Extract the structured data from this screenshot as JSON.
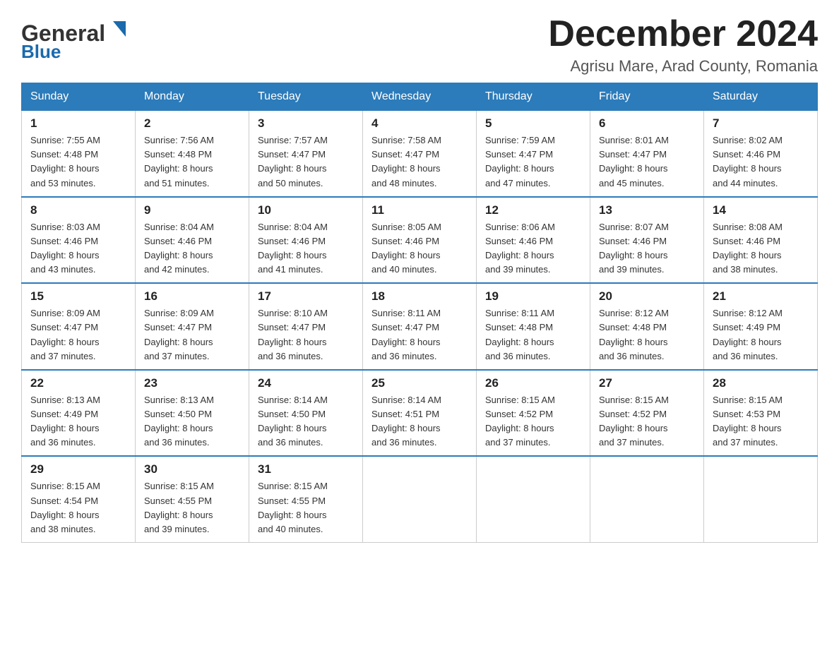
{
  "header": {
    "logo_general": "General",
    "logo_blue": "Blue",
    "month_title": "December 2024",
    "subtitle": "Agrisu Mare, Arad County, Romania"
  },
  "days_of_week": [
    "Sunday",
    "Monday",
    "Tuesday",
    "Wednesday",
    "Thursday",
    "Friday",
    "Saturday"
  ],
  "weeks": [
    [
      {
        "day": "1",
        "sunrise": "7:55 AM",
        "sunset": "4:48 PM",
        "daylight": "8 hours and 53 minutes."
      },
      {
        "day": "2",
        "sunrise": "7:56 AM",
        "sunset": "4:48 PM",
        "daylight": "8 hours and 51 minutes."
      },
      {
        "day": "3",
        "sunrise": "7:57 AM",
        "sunset": "4:47 PM",
        "daylight": "8 hours and 50 minutes."
      },
      {
        "day": "4",
        "sunrise": "7:58 AM",
        "sunset": "4:47 PM",
        "daylight": "8 hours and 48 minutes."
      },
      {
        "day": "5",
        "sunrise": "7:59 AM",
        "sunset": "4:47 PM",
        "daylight": "8 hours and 47 minutes."
      },
      {
        "day": "6",
        "sunrise": "8:01 AM",
        "sunset": "4:47 PM",
        "daylight": "8 hours and 45 minutes."
      },
      {
        "day": "7",
        "sunrise": "8:02 AM",
        "sunset": "4:46 PM",
        "daylight": "8 hours and 44 minutes."
      }
    ],
    [
      {
        "day": "8",
        "sunrise": "8:03 AM",
        "sunset": "4:46 PM",
        "daylight": "8 hours and 43 minutes."
      },
      {
        "day": "9",
        "sunrise": "8:04 AM",
        "sunset": "4:46 PM",
        "daylight": "8 hours and 42 minutes."
      },
      {
        "day": "10",
        "sunrise": "8:04 AM",
        "sunset": "4:46 PM",
        "daylight": "8 hours and 41 minutes."
      },
      {
        "day": "11",
        "sunrise": "8:05 AM",
        "sunset": "4:46 PM",
        "daylight": "8 hours and 40 minutes."
      },
      {
        "day": "12",
        "sunrise": "8:06 AM",
        "sunset": "4:46 PM",
        "daylight": "8 hours and 39 minutes."
      },
      {
        "day": "13",
        "sunrise": "8:07 AM",
        "sunset": "4:46 PM",
        "daylight": "8 hours and 39 minutes."
      },
      {
        "day": "14",
        "sunrise": "8:08 AM",
        "sunset": "4:46 PM",
        "daylight": "8 hours and 38 minutes."
      }
    ],
    [
      {
        "day": "15",
        "sunrise": "8:09 AM",
        "sunset": "4:47 PM",
        "daylight": "8 hours and 37 minutes."
      },
      {
        "day": "16",
        "sunrise": "8:09 AM",
        "sunset": "4:47 PM",
        "daylight": "8 hours and 37 minutes."
      },
      {
        "day": "17",
        "sunrise": "8:10 AM",
        "sunset": "4:47 PM",
        "daylight": "8 hours and 36 minutes."
      },
      {
        "day": "18",
        "sunrise": "8:11 AM",
        "sunset": "4:47 PM",
        "daylight": "8 hours and 36 minutes."
      },
      {
        "day": "19",
        "sunrise": "8:11 AM",
        "sunset": "4:48 PM",
        "daylight": "8 hours and 36 minutes."
      },
      {
        "day": "20",
        "sunrise": "8:12 AM",
        "sunset": "4:48 PM",
        "daylight": "8 hours and 36 minutes."
      },
      {
        "day": "21",
        "sunrise": "8:12 AM",
        "sunset": "4:49 PM",
        "daylight": "8 hours and 36 minutes."
      }
    ],
    [
      {
        "day": "22",
        "sunrise": "8:13 AM",
        "sunset": "4:49 PM",
        "daylight": "8 hours and 36 minutes."
      },
      {
        "day": "23",
        "sunrise": "8:13 AM",
        "sunset": "4:50 PM",
        "daylight": "8 hours and 36 minutes."
      },
      {
        "day": "24",
        "sunrise": "8:14 AM",
        "sunset": "4:50 PM",
        "daylight": "8 hours and 36 minutes."
      },
      {
        "day": "25",
        "sunrise": "8:14 AM",
        "sunset": "4:51 PM",
        "daylight": "8 hours and 36 minutes."
      },
      {
        "day": "26",
        "sunrise": "8:15 AM",
        "sunset": "4:52 PM",
        "daylight": "8 hours and 37 minutes."
      },
      {
        "day": "27",
        "sunrise": "8:15 AM",
        "sunset": "4:52 PM",
        "daylight": "8 hours and 37 minutes."
      },
      {
        "day": "28",
        "sunrise": "8:15 AM",
        "sunset": "4:53 PM",
        "daylight": "8 hours and 37 minutes."
      }
    ],
    [
      {
        "day": "29",
        "sunrise": "8:15 AM",
        "sunset": "4:54 PM",
        "daylight": "8 hours and 38 minutes."
      },
      {
        "day": "30",
        "sunrise": "8:15 AM",
        "sunset": "4:55 PM",
        "daylight": "8 hours and 39 minutes."
      },
      {
        "day": "31",
        "sunrise": "8:15 AM",
        "sunset": "4:55 PM",
        "daylight": "8 hours and 40 minutes."
      },
      null,
      null,
      null,
      null
    ]
  ],
  "labels": {
    "sunrise": "Sunrise:",
    "sunset": "Sunset:",
    "daylight": "Daylight:"
  }
}
